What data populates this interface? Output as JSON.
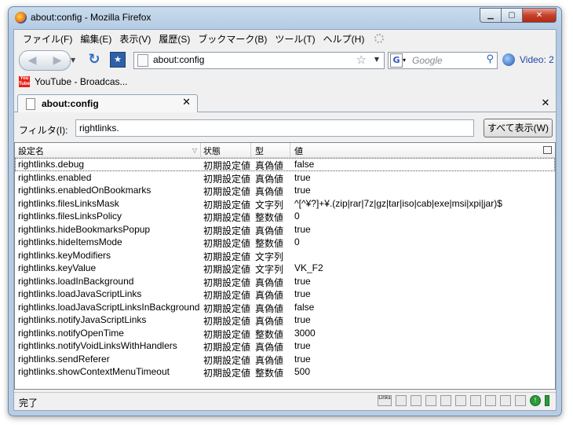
{
  "window": {
    "title": "about:config - Mozilla Firefox"
  },
  "menubar": [
    "ファイル(F)",
    "編集(E)",
    "表示(V)",
    "履歴(S)",
    "ブックマーク(B)",
    "ツール(T)",
    "ヘルプ(H)"
  ],
  "navbar": {
    "url": "about:config",
    "search_placeholder": "Google",
    "video_label": "Video: 2"
  },
  "bookmarks": [
    {
      "label": "YouTube - Broadcas...",
      "icon": "youtube-icon"
    }
  ],
  "tab": {
    "label": "about:config"
  },
  "filter": {
    "label": "フィルタ(I):",
    "value": "rightlinks.",
    "show_all": "すべて表示(W)"
  },
  "columns": [
    "設定名",
    "状態",
    "型",
    "値"
  ],
  "prefs": [
    {
      "name": "rightlinks.debug",
      "status": "初期設定値",
      "type": "真偽値",
      "value": "false"
    },
    {
      "name": "rightlinks.enabled",
      "status": "初期設定値",
      "type": "真偽値",
      "value": "true"
    },
    {
      "name": "rightlinks.enabledOnBookmarks",
      "status": "初期設定値",
      "type": "真偽値",
      "value": "true"
    },
    {
      "name": "rightlinks.filesLinksMask",
      "status": "初期設定値",
      "type": "文字列",
      "value": "^[^¥?]+¥.(zip|rar|7z|gz|tar|iso|cab|exe|msi|xpi|jar)$"
    },
    {
      "name": "rightlinks.filesLinksPolicy",
      "status": "初期設定値",
      "type": "整数値",
      "value": "0"
    },
    {
      "name": "rightlinks.hideBookmarksPopup",
      "status": "初期設定値",
      "type": "真偽値",
      "value": "true"
    },
    {
      "name": "rightlinks.hideItemsMode",
      "status": "初期設定値",
      "type": "整数値",
      "value": "0"
    },
    {
      "name": "rightlinks.keyModifiers",
      "status": "初期設定値",
      "type": "文字列",
      "value": ""
    },
    {
      "name": "rightlinks.keyValue",
      "status": "初期設定値",
      "type": "文字列",
      "value": "VK_F2"
    },
    {
      "name": "rightlinks.loadInBackground",
      "status": "初期設定値",
      "type": "真偽値",
      "value": "true"
    },
    {
      "name": "rightlinks.loadJavaScriptLinks",
      "status": "初期設定値",
      "type": "真偽値",
      "value": "true"
    },
    {
      "name": "rightlinks.loadJavaScriptLinksInBackground",
      "status": "初期設定値",
      "type": "真偽値",
      "value": "false"
    },
    {
      "name": "rightlinks.notifyJavaScriptLinks",
      "status": "初期設定値",
      "type": "真偽値",
      "value": "true"
    },
    {
      "name": "rightlinks.notifyOpenTime",
      "status": "初期設定値",
      "type": "整数値",
      "value": "3000"
    },
    {
      "name": "rightlinks.notifyVoidLinksWithHandlers",
      "status": "初期設定値",
      "type": "真偽値",
      "value": "true"
    },
    {
      "name": "rightlinks.sendReferer",
      "status": "初期設定値",
      "type": "真偽値",
      "value": "true"
    },
    {
      "name": "rightlinks.showContextMenuTimeout",
      "status": "初期設定値",
      "type": "整数値",
      "value": "500"
    }
  ],
  "statusbar": {
    "text": "完了",
    "links_label": "Links"
  }
}
